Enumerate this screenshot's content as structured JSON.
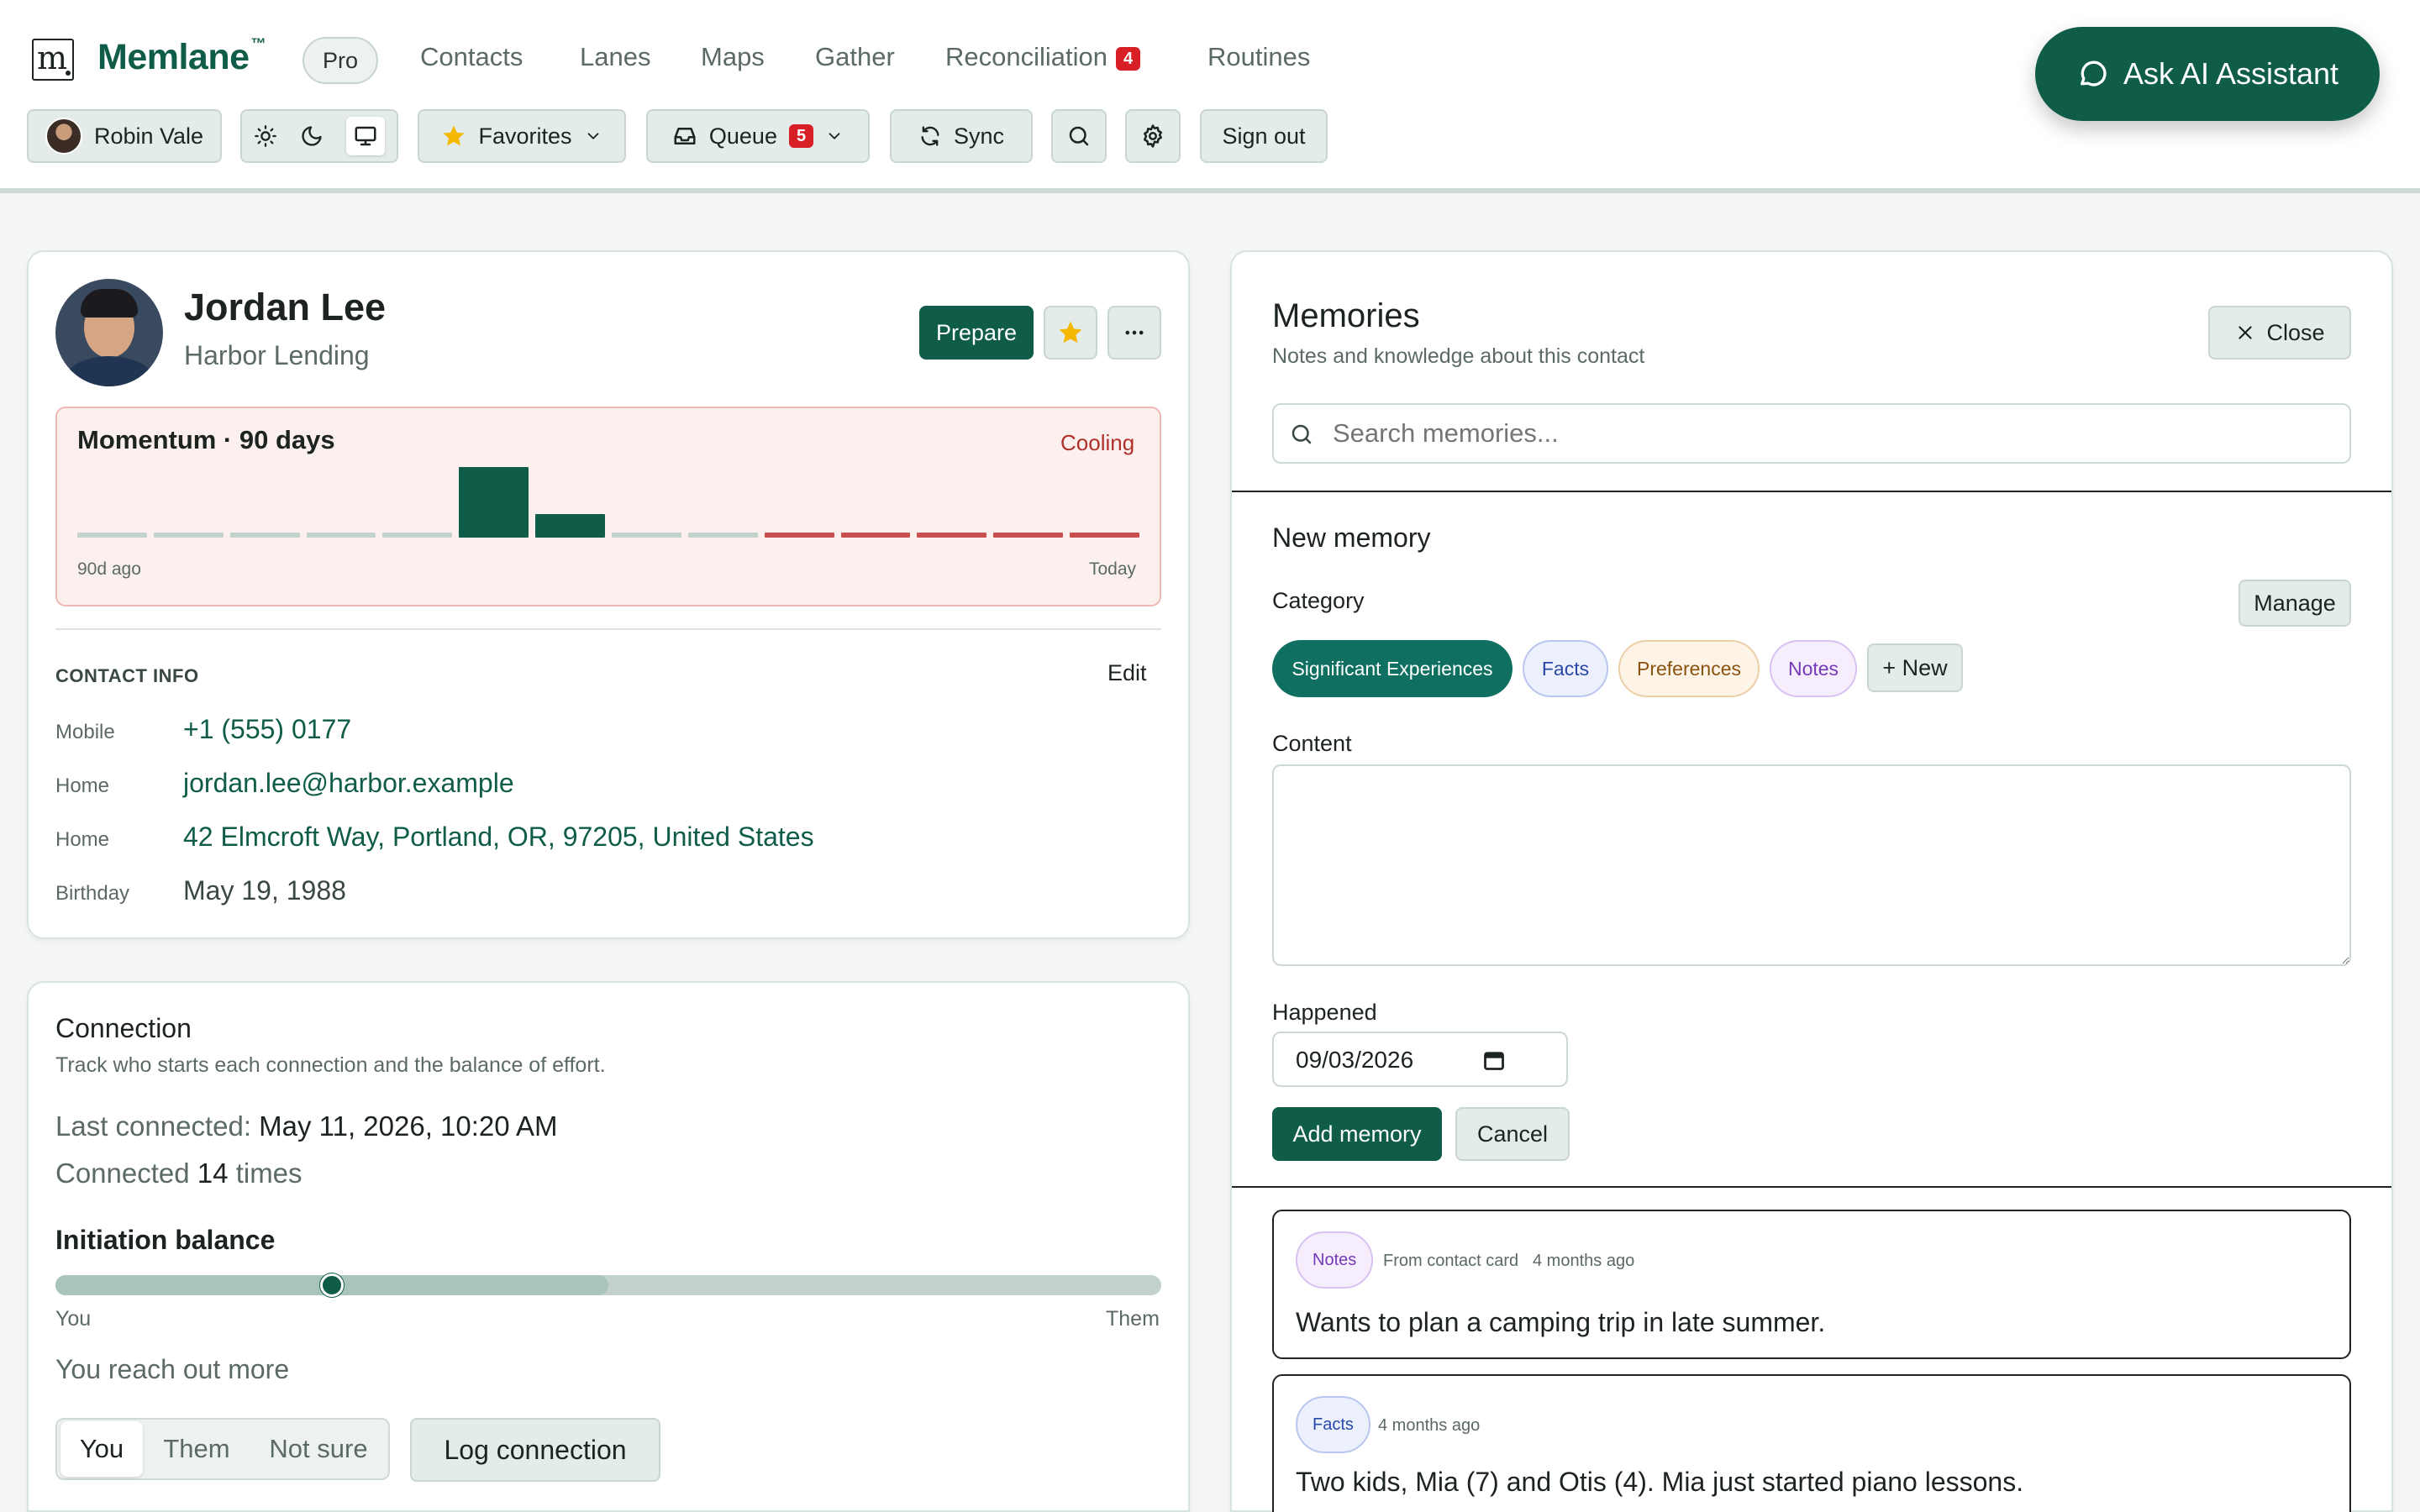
{
  "brand": {
    "name": "Memlane",
    "trademark": "™",
    "logo_letter": "m",
    "plan": "Pro"
  },
  "nav": [
    {
      "label": "Contacts"
    },
    {
      "label": "Lanes"
    },
    {
      "label": "Maps"
    },
    {
      "label": "Gather"
    },
    {
      "label": "Reconciliation",
      "badge": "4"
    },
    {
      "label": "Routines"
    }
  ],
  "toolbar": {
    "user": "Robin Vale",
    "favorites": "Favorites",
    "queue": "Queue",
    "queue_badge": "5",
    "sync": "Sync",
    "sign_out": "Sign out",
    "theme_icons": [
      "sun-icon",
      "moon-icon",
      "monitor-icon"
    ]
  },
  "assistant": {
    "label": "Ask AI Assistant"
  },
  "contact": {
    "name": "Jordan Lee",
    "company": "Harbor Lending",
    "prepare": "Prepare",
    "momentum": {
      "title": "Momentum · 90 days",
      "status": "Cooling",
      "start_label": "90d ago",
      "end_label": "Today"
    },
    "info_heading": "CONTACT INFO",
    "edit": "Edit",
    "info": [
      {
        "label": "Mobile",
        "value": "+1 (555) 0177"
      },
      {
        "label": "Home",
        "value": "jordan.lee@harbor.example"
      },
      {
        "label": "Home",
        "value": "42 Elmcroft Way, Portland, OR, 97205, United States"
      },
      {
        "label": "Birthday",
        "value": "May 19, 1988"
      }
    ]
  },
  "chart_data": {
    "type": "bar",
    "title": "Momentum · 90 days",
    "categories": [
      "90d ago",
      "",
      "",
      "",
      "",
      "",
      "",
      "",
      "",
      "",
      "",
      "",
      "",
      "Today"
    ],
    "values": [
      0,
      0,
      0,
      0,
      0,
      3,
      1,
      0,
      0,
      0,
      0,
      0,
      0,
      0
    ],
    "ylim": [
      0,
      3
    ],
    "bar_states": [
      "neutral",
      "neutral",
      "neutral",
      "neutral",
      "neutral",
      "active",
      "active",
      "neutral",
      "neutral",
      "cooling",
      "cooling",
      "cooling",
      "cooling",
      "cooling"
    ],
    "colors": {
      "neutral": "#c3d2cd",
      "active": "#0f5c49",
      "cooling": "#c9504f"
    }
  },
  "connection": {
    "title": "Connection",
    "subtitle": "Track who starts each connection and the balance of effort.",
    "last_label": "Last connected:",
    "last_value": "May 11, 2026, 10:20 AM",
    "count_prefix": "Connected",
    "count": "14",
    "count_suffix": "times",
    "balance_title": "Initiation balance",
    "balance_left": "You",
    "balance_right": "Them",
    "balance_value": 0.25,
    "summary": "You reach out more",
    "options": [
      "You",
      "Them",
      "Not sure"
    ],
    "selected": "You",
    "log": "Log connection"
  },
  "memories": {
    "title": "Memories",
    "subtitle": "Notes and knowledge about this contact",
    "close": "Close",
    "search_placeholder": "Search memories...",
    "new_title": "New memory",
    "category_label": "Category",
    "manage": "Manage",
    "categories": [
      {
        "label": "Significant Experiences",
        "selected": true
      },
      {
        "label": "Facts"
      },
      {
        "label": "Preferences"
      },
      {
        "label": "Notes"
      }
    ],
    "new_category": "+ New",
    "content_label": "Content",
    "content_value": "",
    "happened_label": "Happened",
    "happened_value": "09/03/2026",
    "add": "Add memory",
    "cancel": "Cancel",
    "items": [
      {
        "tag": "Notes",
        "source": "From contact card",
        "time": "4 months ago",
        "text": "Wants to plan a camping trip in late summer."
      },
      {
        "tag": "Facts",
        "source": "",
        "time": "4 months ago",
        "text": "Two kids, Mia (7) and Otis (4). Mia just started piano lessons."
      }
    ]
  }
}
